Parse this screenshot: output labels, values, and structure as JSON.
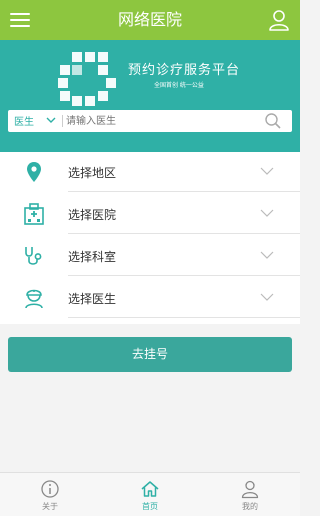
{
  "header": {
    "title": "网络医院"
  },
  "banner": {
    "slogan": "预约诊疗服务平台",
    "sub": "全国首创  统一公益"
  },
  "search": {
    "type_selected": "医生",
    "placeholder": "请输入医生"
  },
  "filters": [
    {
      "label": "选择地区",
      "icon": "location-icon"
    },
    {
      "label": "选择医院",
      "icon": "hospital-icon"
    },
    {
      "label": "选择科室",
      "icon": "stethoscope-icon"
    },
    {
      "label": "选择医生",
      "icon": "doctor-icon"
    }
  ],
  "register_button": "去挂号",
  "tabs": [
    {
      "label": "关于",
      "icon": "info-icon",
      "active": false
    },
    {
      "label": "首页",
      "icon": "home-icon",
      "active": true
    },
    {
      "label": "我的",
      "icon": "user-icon",
      "active": false
    }
  ],
  "colors": {
    "header_green": "#8dc63f",
    "teal": "#2fb0a6",
    "button_teal": "#3aa79c"
  }
}
